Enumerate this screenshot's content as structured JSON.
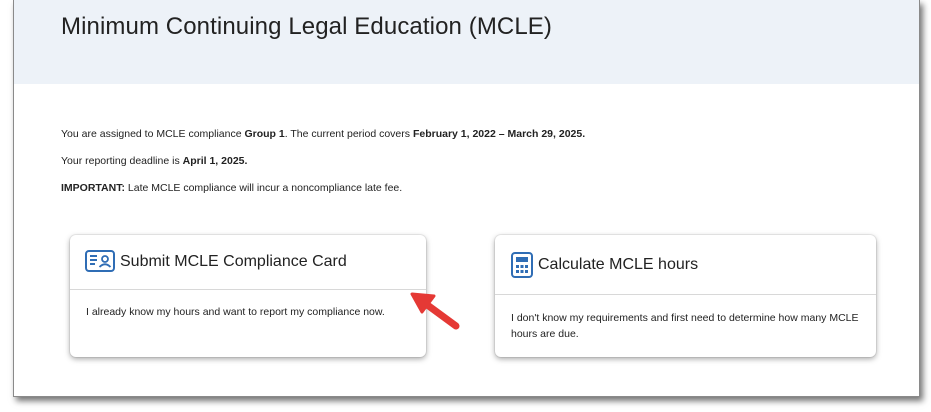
{
  "page": {
    "title": "Minimum Continuing Legal Education (MCLE)"
  },
  "info": {
    "line1_pre": "You are assigned to MCLE compliance ",
    "line1_group": "Group 1",
    "line1_mid": ". The current period covers ",
    "line1_period": "February 1, 2022 – March 29, 2025.",
    "line2_pre": "Your reporting deadline is ",
    "line2_deadline": "April 1, 2025.",
    "line3_label": "IMPORTANT:",
    "line3_text": " Late MCLE compliance will incur a noncompliance late fee."
  },
  "cards": [
    {
      "title": "Submit MCLE Compliance Card",
      "icon": "id-card-icon",
      "description": "I already know my hours and want to report my compliance now."
    },
    {
      "title": "Calculate MCLE hours",
      "icon": "calculator-icon",
      "description": "I don't know my requirements and first need to determine how many MCLE hours are due."
    }
  ],
  "colors": {
    "header_band": "#edf2f8",
    "icon_blue": "#2f6db5",
    "arrow_red": "#e53935"
  }
}
